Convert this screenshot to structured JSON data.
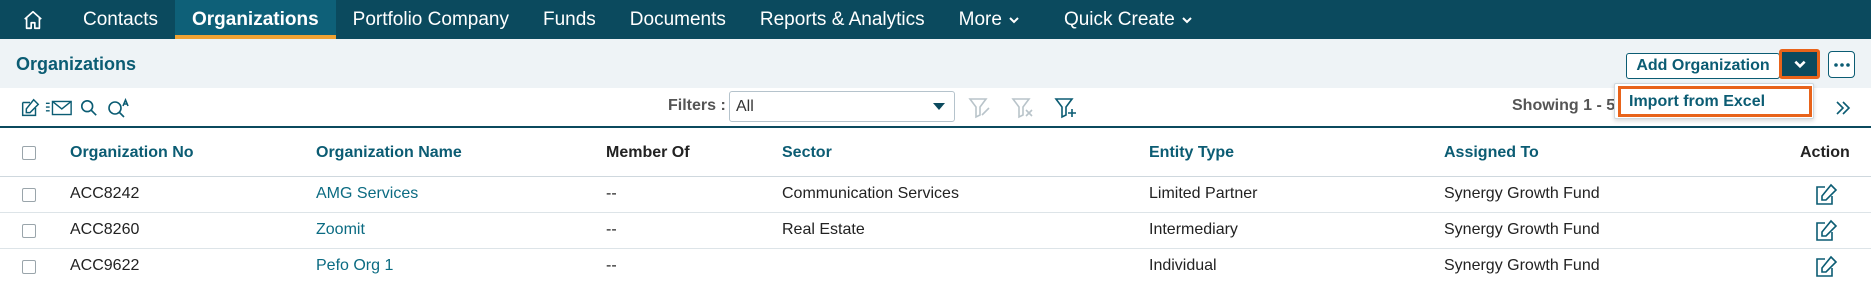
{
  "nav": {
    "items": [
      {
        "label": "Contacts"
      },
      {
        "label": "Organizations"
      },
      {
        "label": "Portfolio Company"
      },
      {
        "label": "Funds"
      },
      {
        "label": "Documents"
      },
      {
        "label": "Reports & Analytics"
      },
      {
        "label": "More"
      },
      {
        "label": "Quick Create"
      }
    ],
    "active": "Organizations"
  },
  "header": {
    "title": "Organizations",
    "add_button": "Add Organization"
  },
  "dropdown": {
    "item": "Import from Excel"
  },
  "toolbar": {
    "filters_label": "Filters :",
    "filters_value": "All",
    "showing": "Showing 1 - 5"
  },
  "table": {
    "headers": {
      "org_no": "Organization No",
      "org_name": "Organization Name",
      "member_of": "Member Of",
      "sector": "Sector",
      "entity_type": "Entity Type",
      "assigned_to": "Assigned To",
      "action": "Action"
    },
    "rows": [
      {
        "org_no": "ACC8242",
        "org_name": "AMG Services",
        "member_of": "--",
        "sector": "Communication Services",
        "entity_type": "Limited Partner",
        "assigned_to": "Synergy Growth Fund"
      },
      {
        "org_no": "ACC8260",
        "org_name": "Zoomit",
        "member_of": "--",
        "sector": "Real Estate",
        "entity_type": "Intermediary",
        "assigned_to": "Synergy Growth Fund"
      },
      {
        "org_no": "ACC9622",
        "org_name": "Pefo Org 1",
        "member_of": "--",
        "sector": "",
        "entity_type": "Individual",
        "assigned_to": "Synergy Growth Fund"
      }
    ]
  },
  "colors": {
    "nav_bg": "#0b4a5e",
    "accent": "#0b5c73",
    "active_underline": "#f0a233",
    "highlight": "#e8631a"
  }
}
